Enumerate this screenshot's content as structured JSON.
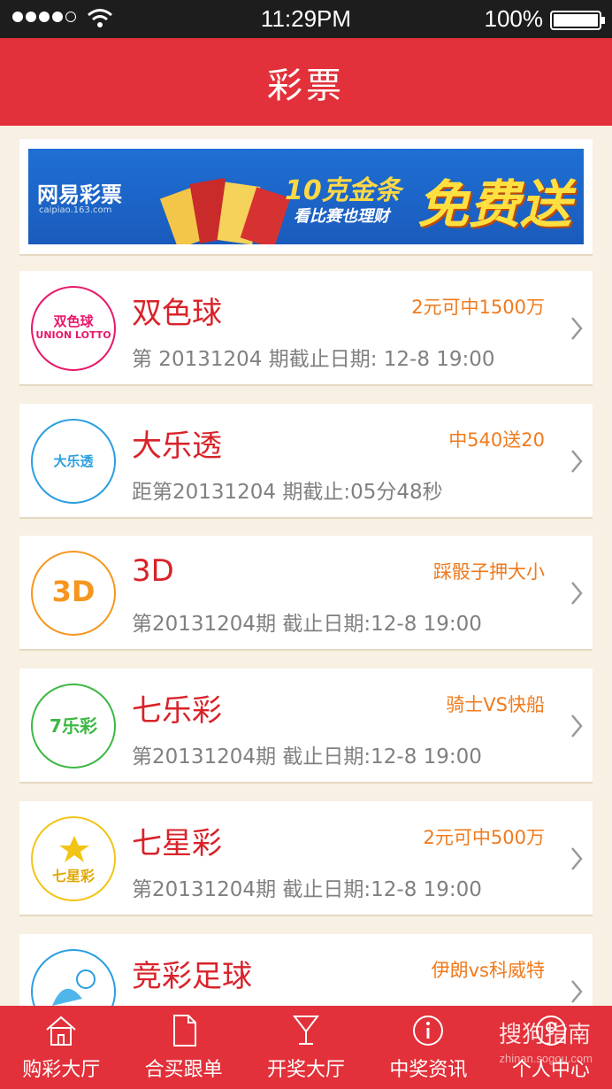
{
  "status_bar": {
    "time": "11:29PM",
    "battery": "100%",
    "battery_level": 1.0
  },
  "nav": {
    "title": "彩票"
  },
  "banner": {
    "logo": "网易彩票",
    "site": "caipiao.163.com",
    "headline": "10克金条",
    "sub": "看比赛也理财",
    "free": "免费送"
  },
  "lotteries": [
    {
      "name": "双色球",
      "promo": "2元可中1500万",
      "info": "第 20131204  期截止日期: 12-8 19:00",
      "logo_text": "双色球",
      "logo_sub": "UNION LOTTO",
      "color": "#e8186a",
      "icon": "union-lotto-icon"
    },
    {
      "name": "大乐透",
      "promo": "中540送20",
      "info": "距第20131204  期截止:05分48秒",
      "logo_text": "大乐透",
      "logo_sub": "",
      "color": "#2a9ee0",
      "icon": "super-lotto-icon"
    },
    {
      "name": "3D",
      "promo": "踩骰子押大小",
      "info": "第20131204期  截止日期:12-8 19:00",
      "logo_text": "3D",
      "logo_sub": "",
      "color": "#f5971f",
      "icon": "3d-lottery-icon"
    },
    {
      "name": "七乐彩",
      "promo": "骑士VS快船",
      "info": "第20131204期  截止日期:12-8 19:00",
      "logo_text": "7乐彩",
      "logo_sub": "",
      "color": "#3cb843",
      "icon": "seven-happy-icon"
    },
    {
      "name": "七星彩",
      "promo": "2元可中500万",
      "info": "第20131204期  截止日期:12-8 19:00",
      "logo_text": "七星彩",
      "logo_sub": "",
      "color": "#f2c417",
      "icon": "seven-star-icon"
    },
    {
      "name": "竞彩足球",
      "promo": "伊朗vs科威特",
      "info": "",
      "logo_text": "",
      "logo_sub": "",
      "color": "#2a9ee0",
      "icon": "football-icon"
    }
  ],
  "tabs": [
    {
      "label": "购彩大厅",
      "icon": "house-icon"
    },
    {
      "label": "合买跟单",
      "icon": "document-icon"
    },
    {
      "label": "开奖大厅",
      "icon": "trophy-cup-icon"
    },
    {
      "label": "中奖资讯",
      "icon": "info-icon"
    },
    {
      "label": "个人中心",
      "icon": "person-icon"
    }
  ],
  "watermark": {
    "text": "搜狗指南",
    "sub": "zhinan.sogou.com"
  }
}
